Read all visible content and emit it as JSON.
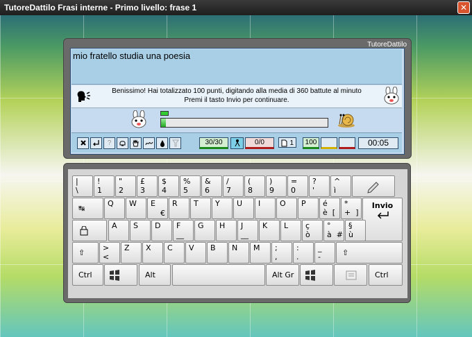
{
  "window": {
    "title": "TutoreDattilo Frasi interne - Primo livello: frase 1",
    "close_glyph": "✕"
  },
  "device": {
    "brand": "TutoreDattilo"
  },
  "phrase": "mio fratello studia una poesia",
  "message": {
    "line1": "Benissimo! Hai totalizzato 100 punti, digitando alla media di 360 battute al minuto",
    "line2": "Premi il tasto Invio per continuare."
  },
  "progress": {
    "fraction": 0.03
  },
  "toolbar": {
    "help": "?",
    "progress_count": "30/30",
    "errors": "0/0",
    "page": "1",
    "score": "100",
    "time": "00:05"
  },
  "keyboard": {
    "row1": [
      {
        "top": "|",
        "bottom": "\\"
      },
      {
        "top": "!",
        "bottom": "1"
      },
      {
        "top": "\"",
        "bottom": "2"
      },
      {
        "top": "£",
        "bottom": "3"
      },
      {
        "top": "$",
        "bottom": "4"
      },
      {
        "top": "%",
        "bottom": "5"
      },
      {
        "top": "&",
        "bottom": "6"
      },
      {
        "top": "/",
        "bottom": "7"
      },
      {
        "top": "(",
        "bottom": "8"
      },
      {
        "top": ")",
        "bottom": "9"
      },
      {
        "top": "=",
        "bottom": "0"
      },
      {
        "top": "?",
        "bottom": "'"
      },
      {
        "top": "^",
        "bottom": "ì"
      }
    ],
    "row2": [
      {
        "top": "Q"
      },
      {
        "top": "W"
      },
      {
        "top": "E",
        "extra": "€"
      },
      {
        "top": "R"
      },
      {
        "top": "T"
      },
      {
        "top": "Y"
      },
      {
        "top": "U"
      },
      {
        "top": "I"
      },
      {
        "top": "O"
      },
      {
        "top": "P"
      },
      {
        "top": "é",
        "bottom": "è  ["
      },
      {
        "top": "*",
        "bottom": "+  ]"
      }
    ],
    "row3": [
      {
        "top": "A"
      },
      {
        "top": "S"
      },
      {
        "top": "D"
      },
      {
        "top": "F",
        "bottom": "__"
      },
      {
        "top": "G"
      },
      {
        "top": "H"
      },
      {
        "top": "J",
        "bottom": "__"
      },
      {
        "top": "K"
      },
      {
        "top": "L"
      },
      {
        "top": "ç",
        "bottom": "ò"
      },
      {
        "top": "°",
        "bottom": "à  #"
      },
      {
        "top": "§",
        "bottom": "ù"
      }
    ],
    "row4": [
      {
        "top": ">",
        "bottom": "<"
      },
      {
        "top": "Z"
      },
      {
        "top": "X"
      },
      {
        "top": "C"
      },
      {
        "top": "V"
      },
      {
        "top": "B"
      },
      {
        "top": "N"
      },
      {
        "top": "M"
      },
      {
        "top": ";",
        "bottom": ","
      },
      {
        "top": ":",
        "bottom": "."
      },
      {
        "top": "_",
        "bottom": "-"
      }
    ],
    "enter_label": "Invio",
    "ctrl_left": "Ctrl",
    "alt": "Alt",
    "altgr": "Alt Gr",
    "ctrl_right": "Ctrl",
    "shift_glyph": "⇧",
    "tab_glyph": "↹"
  },
  "colors": {
    "accent_green": "#1a8a1a",
    "accent_red": "#b01c1c",
    "screen_blue": "#a9cfe6"
  }
}
